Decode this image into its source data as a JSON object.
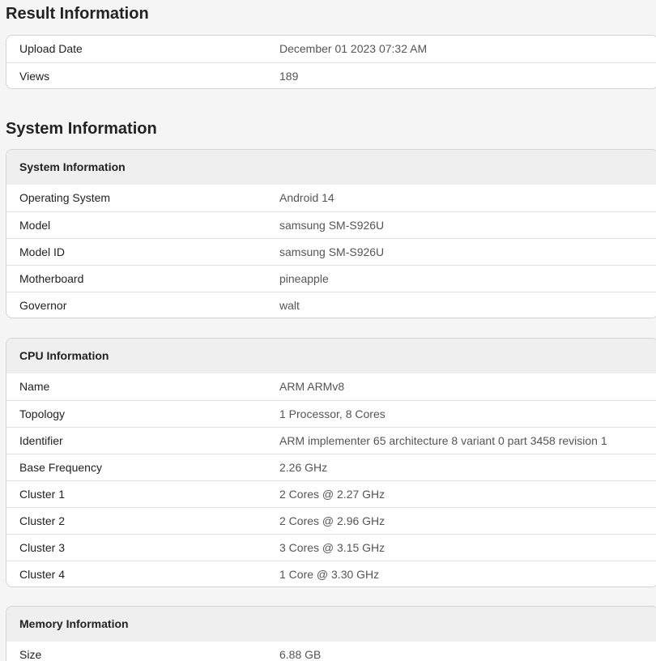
{
  "result_information": {
    "title": "Result Information",
    "rows": [
      {
        "label": "Upload Date",
        "value": "December 01 2023 07:32 AM"
      },
      {
        "label": "Views",
        "value": "189"
      }
    ]
  },
  "system_information": {
    "title": "System Information",
    "system_card": {
      "heading": "System Information",
      "rows": [
        {
          "label": "Operating System",
          "value": "Android 14"
        },
        {
          "label": "Model",
          "value": "samsung SM-S926U"
        },
        {
          "label": "Model ID",
          "value": "samsung SM-S926U"
        },
        {
          "label": "Motherboard",
          "value": "pineapple"
        },
        {
          "label": "Governor",
          "value": "walt"
        }
      ]
    },
    "cpu_card": {
      "heading": "CPU Information",
      "rows": [
        {
          "label": "Name",
          "value": "ARM ARMv8"
        },
        {
          "label": "Topology",
          "value": "1 Processor, 8 Cores"
        },
        {
          "label": "Identifier",
          "value": "ARM implementer 65 architecture 8 variant 0 part 3458 revision 1"
        },
        {
          "label": "Base Frequency",
          "value": "2.26 GHz"
        },
        {
          "label": "Cluster 1",
          "value": "2 Cores @ 2.27 GHz"
        },
        {
          "label": "Cluster 2",
          "value": "2 Cores @ 2.96 GHz"
        },
        {
          "label": "Cluster 3",
          "value": "3 Cores @ 3.15 GHz"
        },
        {
          "label": "Cluster 4",
          "value": "1 Core @ 3.30 GHz"
        }
      ]
    },
    "memory_card": {
      "heading": "Memory Information",
      "rows": [
        {
          "label": "Size",
          "value": "6.88 GB"
        }
      ]
    }
  }
}
